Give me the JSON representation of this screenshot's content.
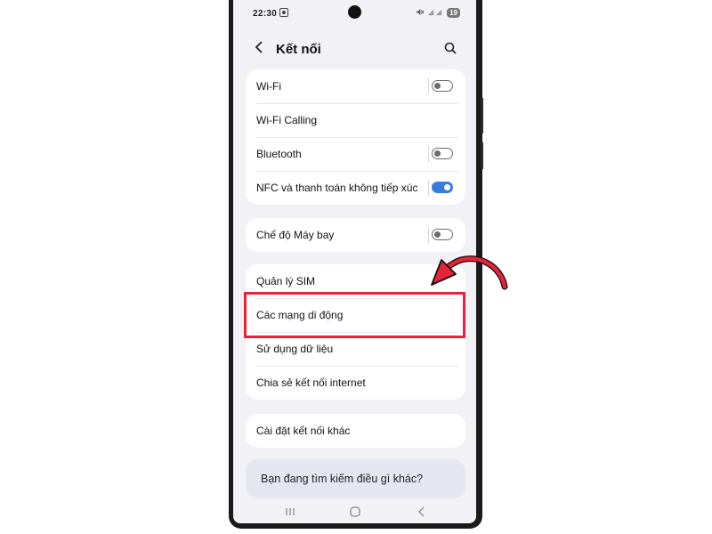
{
  "status_bar": {
    "time": "22:30",
    "battery": "19",
    "icons": [
      "screen-record-icon",
      "mute-icon",
      "signal-icon",
      "battery-icon"
    ]
  },
  "header": {
    "title": "Kết nối",
    "back_icon": "back-arrow-icon",
    "search_icon": "search-icon"
  },
  "group1": [
    {
      "label": "Wi-Fi",
      "toggle": "off"
    },
    {
      "label": "Wi-Fi Calling"
    },
    {
      "label": "Bluetooth",
      "toggle": "off"
    },
    {
      "label": "NFC và thanh toán không tiếp xúc",
      "toggle": "on"
    }
  ],
  "group2": [
    {
      "label": "Chế độ Máy bay",
      "toggle": "off"
    }
  ],
  "group3": [
    {
      "label": "Quản lý SIM"
    },
    {
      "label": "Các mạng di động"
    },
    {
      "label": "Sử dụng dữ liệu"
    },
    {
      "label": "Chia sẻ kết nối internet"
    }
  ],
  "group4": [
    {
      "label": "Cài đặt kết nối khác"
    }
  ],
  "suggestion": {
    "label": "Bạn đang tìm kiếm điều gì khác?"
  },
  "nav_bar": {
    "icons": [
      "recent-apps-icon",
      "home-icon",
      "back-icon"
    ]
  },
  "annotation": {
    "highlight_color": "#e8223a",
    "highlighted_item": "Các mạng di động"
  },
  "colors": {
    "toggle_on": "#3a7be0",
    "background": "#f2f1f6"
  }
}
